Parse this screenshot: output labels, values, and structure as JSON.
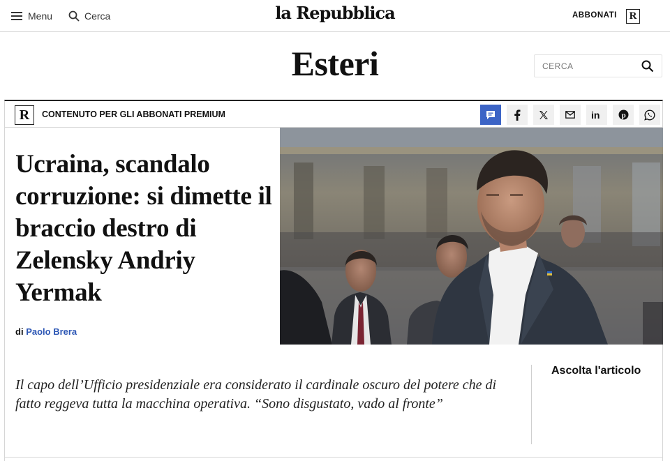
{
  "header": {
    "menu_label": "Menu",
    "search_label": "Cerca",
    "logo": "la Repubblica",
    "subscribe_label": "ABBONATI",
    "badge_letter": "R"
  },
  "section": {
    "title": "Esteri",
    "search_placeholder": "CERCA"
  },
  "article": {
    "premium_badge": "R",
    "premium_label": "CONTENUTO PER GLI ABBONATI PREMIUM",
    "headline": "Ucraina, scandalo corruzione: si dimette il braccio destro di Zelensky Andriy Yermak",
    "byline_prefix": "di",
    "author": "Paolo Brera",
    "summary": "Il capo dell’Ufficio presidenziale era considerato il cardinale oscuro del potere che di fatto reggeva tutta la macchina operativa. “Sono disgustato, vado al fronte”",
    "listen_label": "Ascolta l'articolo"
  },
  "share": {
    "icons": [
      "comment-icon",
      "facebook-icon",
      "x-icon",
      "email-icon",
      "linkedin-icon",
      "pinterest-icon",
      "whatsapp-icon"
    ],
    "active_color": "#3c64c6"
  },
  "colors": {
    "link": "#2d57b5",
    "text": "#111111"
  }
}
